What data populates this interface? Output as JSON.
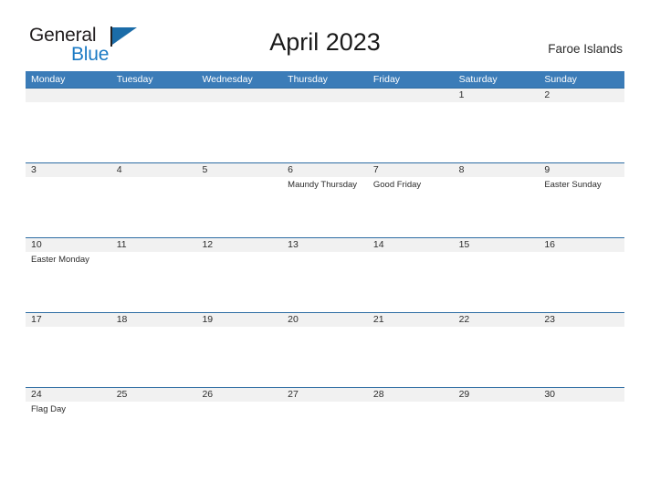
{
  "brand": {
    "name_part1": "General",
    "name_part2": "Blue",
    "flag_icon": "blue-flag-triangle"
  },
  "header": {
    "title": "April 2023",
    "region": "Faroe Islands"
  },
  "calendar": {
    "weekday_headers": [
      "Monday",
      "Tuesday",
      "Wednesday",
      "Thursday",
      "Friday",
      "Saturday",
      "Sunday"
    ],
    "colors": {
      "header_blue": "#3b7cb8",
      "row_divider": "#2d6ca3",
      "date_band_gray": "#f1f1f1",
      "logo_blue": "#1b7ac4",
      "text": "#2c2c2c"
    },
    "weeks": [
      {
        "dates": [
          "",
          "",
          "",
          "",
          "",
          "1",
          "2"
        ],
        "events": [
          "",
          "",
          "",
          "",
          "",
          "",
          ""
        ]
      },
      {
        "dates": [
          "3",
          "4",
          "5",
          "6",
          "7",
          "8",
          "9"
        ],
        "events": [
          "",
          "",
          "",
          "Maundy Thursday",
          "Good Friday",
          "",
          "Easter Sunday"
        ]
      },
      {
        "dates": [
          "10",
          "11",
          "12",
          "13",
          "14",
          "15",
          "16"
        ],
        "events": [
          "Easter Monday",
          "",
          "",
          "",
          "",
          "",
          ""
        ]
      },
      {
        "dates": [
          "17",
          "18",
          "19",
          "20",
          "21",
          "22",
          "23"
        ],
        "events": [
          "",
          "",
          "",
          "",
          "",
          "",
          ""
        ]
      },
      {
        "dates": [
          "24",
          "25",
          "26",
          "27",
          "28",
          "29",
          "30"
        ],
        "events": [
          "Flag Day",
          "",
          "",
          "",
          "",
          "",
          ""
        ]
      }
    ]
  }
}
